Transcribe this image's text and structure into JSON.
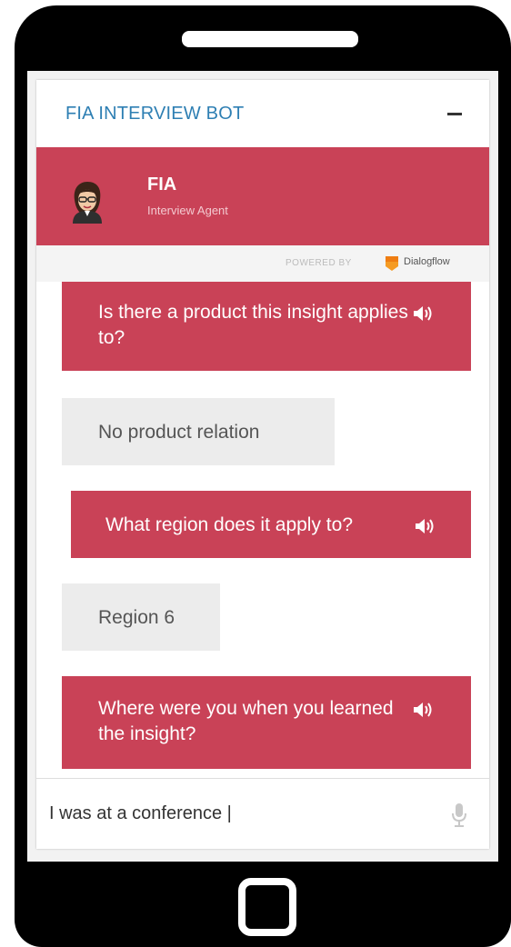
{
  "widget": {
    "title": "FIA INTERVIEW BOT",
    "minimize_icon": "minimize-icon"
  },
  "agent": {
    "name": "FIA",
    "role": "Interview Agent",
    "avatar_icon": "agent-avatar-icon"
  },
  "powered_by": {
    "label": "POWERED BY",
    "brand": "Dialogflow",
    "brand_icon": "dialogflow-logo-icon"
  },
  "messages": [
    {
      "sender": "bot",
      "text": "Is there a product this insight applies to?",
      "icon": "speaker-icon"
    },
    {
      "sender": "user",
      "text": "No product relation"
    },
    {
      "sender": "bot",
      "text": "What region does it apply to?",
      "icon": "speaker-icon"
    },
    {
      "sender": "user",
      "text": "Region 6"
    },
    {
      "sender": "bot",
      "text": "Where were you when you learned the insight?",
      "icon": "speaker-icon"
    }
  ],
  "input": {
    "value": "I was at a conference |",
    "mic_icon": "microphone-icon"
  },
  "colors": {
    "accent": "#c94257",
    "title": "#2e7fb3",
    "user_bubble": "#ececec",
    "phone_body": "#000000"
  }
}
